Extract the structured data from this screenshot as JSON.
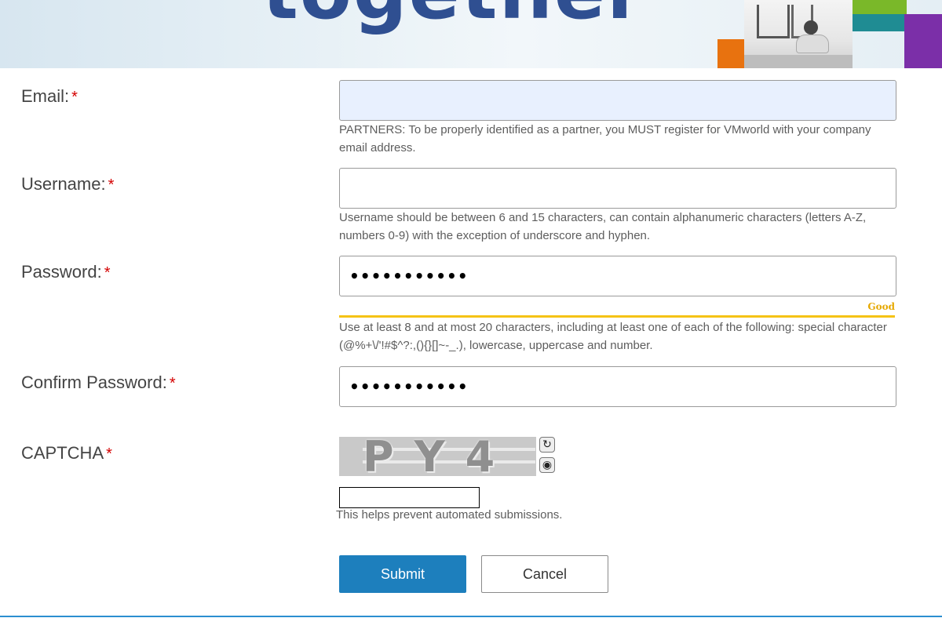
{
  "banner": {
    "word": "together"
  },
  "form": {
    "email": {
      "label": "Email:",
      "required_mark": "*",
      "value": "",
      "help": "PARTNERS: To be properly identified as a partner, you MUST register for VMworld with your company email address."
    },
    "username": {
      "label": "Username:",
      "required_mark": "*",
      "value": "",
      "help": "Username should be between 6 and 15 characters, can contain alphanumeric characters (letters A-Z, numbers 0-9) with the exception of underscore and hyphen."
    },
    "password": {
      "label": "Password:",
      "required_mark": "*",
      "value": "•••••••••••",
      "strength": "Good",
      "strength_color": "#f5c315",
      "help": "Use at least 8 and at most 20 characters, including at least one of each of the following: special character (@%+\\/'!#$^?:,(){}[]~-_.), lowercase, uppercase and number."
    },
    "confirm_password": {
      "label": "Confirm Password:",
      "required_mark": "*",
      "value": "•••••••••••"
    },
    "captcha": {
      "label": "CAPTCHA",
      "required_mark": "*",
      "image_text": "PY4",
      "refresh_icon": "refresh-icon",
      "audio_icon": "audio-icon",
      "value": "",
      "help": "This helps prevent automated submissions."
    }
  },
  "buttons": {
    "submit": "Submit",
    "cancel": "Cancel"
  },
  "colors": {
    "accent": "#1d7fbd",
    "required": "#d40000",
    "autofill": "#e8f0fe"
  }
}
